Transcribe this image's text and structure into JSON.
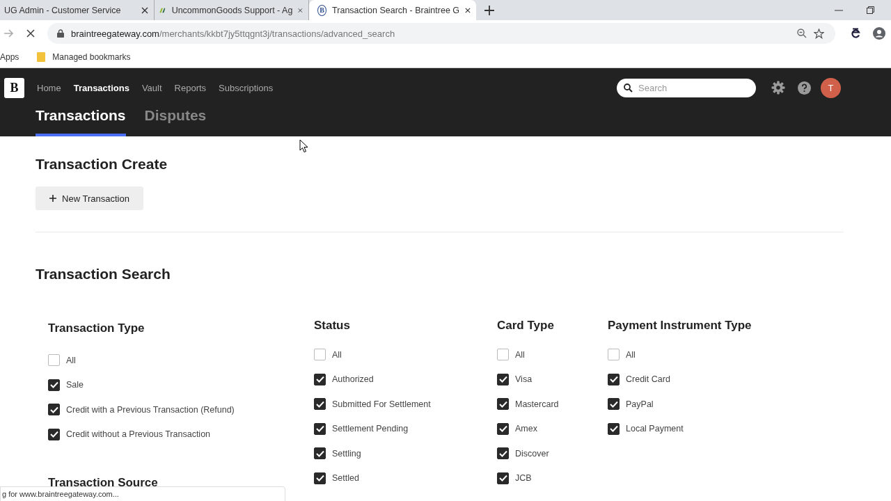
{
  "browser": {
    "tabs": [
      {
        "kind": "plain",
        "title": "UG Admin - Customer Service",
        "selected": false
      },
      {
        "kind": "logo",
        "title": "UncommonGoods Support - Ag",
        "selected": false
      },
      {
        "kind": "letter",
        "favicon": "B",
        "title": "Transaction Search - Braintree G",
        "selected": true
      }
    ],
    "url_host": "braintreegateway.com",
    "url_path": "/merchants/kkbt7jy5ttqgnt3j/transactions/advanced_search",
    "bookmarks": [
      "Apps",
      "Managed bookmarks"
    ]
  },
  "nav": {
    "logo": "B",
    "items": [
      {
        "label": "Home",
        "selected": false
      },
      {
        "label": "Transactions",
        "selected": true
      },
      {
        "label": "Vault",
        "selected": false
      },
      {
        "label": "Reports",
        "selected": false
      },
      {
        "label": "Subscriptions",
        "selected": false
      }
    ],
    "search": {
      "placeholder": "Search"
    },
    "avatar": "T"
  },
  "tabs": [
    {
      "label": "Transactions",
      "selected": true
    },
    {
      "label": "Disputes",
      "selected": false
    }
  ],
  "create": {
    "title": "Transaction Create",
    "button": "New Transaction"
  },
  "search_title": "Transaction Search",
  "filters": [
    {
      "title": "Transaction Type",
      "options": [
        {
          "label": "All",
          "checked": false
        },
        {
          "label": "Sale",
          "checked": true
        },
        {
          "label": "Credit with a Previous Transaction (Refund)",
          "checked": true
        },
        {
          "label": "Credit without a Previous Transaction",
          "checked": true
        }
      ]
    },
    {
      "title": "Status",
      "options": [
        {
          "label": "All",
          "checked": false
        },
        {
          "label": "Authorized",
          "checked": true
        },
        {
          "label": "Submitted For Settlement",
          "checked": true
        },
        {
          "label": "Settlement Pending",
          "checked": true
        },
        {
          "label": "Settling",
          "checked": true
        },
        {
          "label": "Settled",
          "checked": true
        }
      ]
    },
    {
      "title": "Card Type",
      "options": [
        {
          "label": "All",
          "checked": false
        },
        {
          "label": "Visa",
          "checked": true
        },
        {
          "label": "Mastercard",
          "checked": true
        },
        {
          "label": "Amex",
          "checked": true
        },
        {
          "label": "Discover",
          "checked": true
        },
        {
          "label": "JCB",
          "checked": true
        }
      ]
    },
    {
      "title": "Payment Instrument Type",
      "options": [
        {
          "label": "All",
          "checked": false
        },
        {
          "label": "Credit Card",
          "checked": true
        },
        {
          "label": "PayPal",
          "checked": true
        },
        {
          "label": "Local Payment",
          "checked": true
        }
      ]
    }
  ],
  "next_section": "Transaction Source",
  "status_bubble": "g for www.braintreegateway.com..."
}
